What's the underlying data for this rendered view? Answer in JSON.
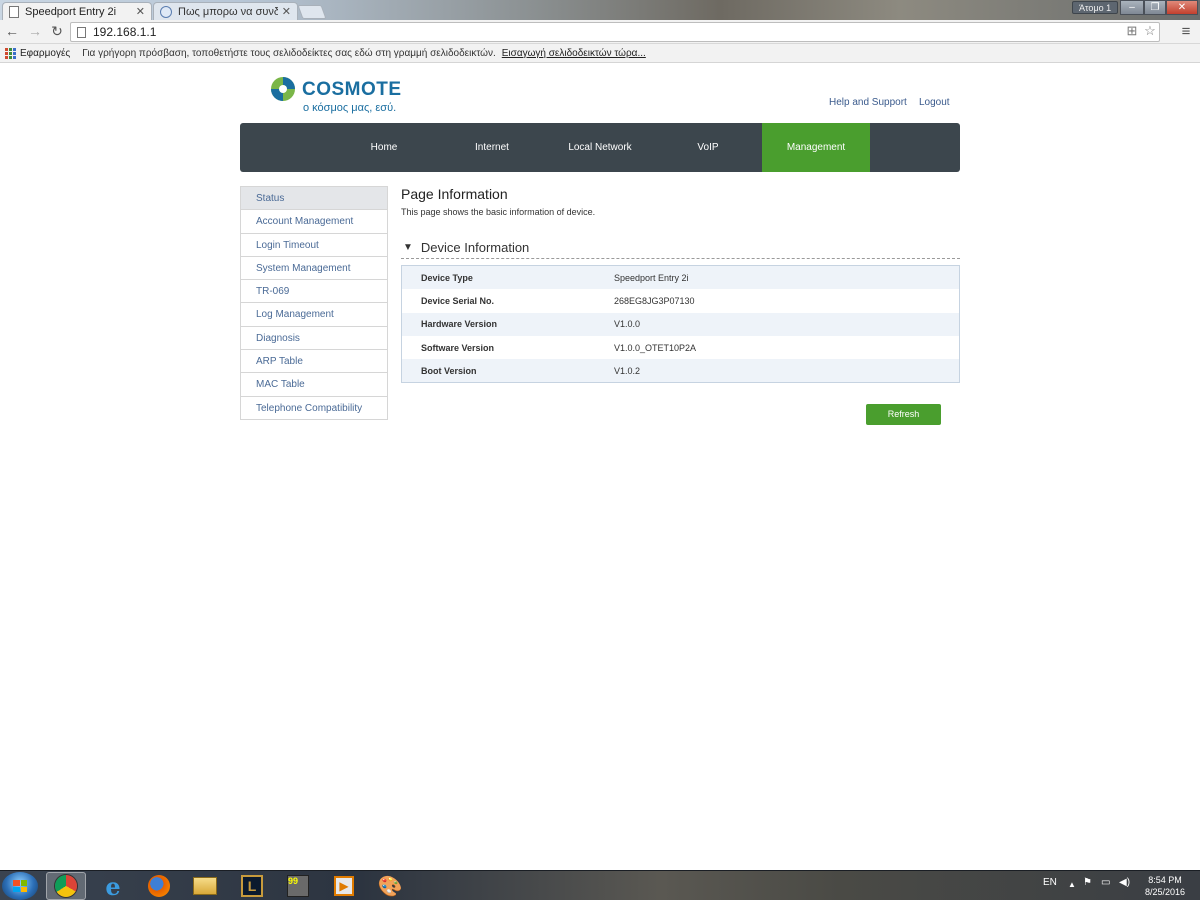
{
  "browser": {
    "tabs": [
      {
        "label": "Speedport Entry 2i",
        "active": true
      },
      {
        "label": "Πως μπορω να συνδεσω",
        "active": false
      }
    ],
    "user_badge": "Άτομο 1",
    "url": "192.168.1.1",
    "bookmarks": {
      "apps_label": "Εφαρμογές",
      "hint": "Για γρήγορη πρόσβαση, τοποθετήστε τους σελιδοδείκτες σας εδώ στη γραμμή σελιδοδεικτών.",
      "import_link": "Εισαγωγή σελιδοδεικτών τώρα..."
    }
  },
  "router": {
    "brand": "COSMOTE",
    "tagline": "ο κόσμος μας, εσύ.",
    "top_links": {
      "help": "Help and Support",
      "logout": "Logout"
    },
    "nav": [
      "Home",
      "Internet",
      "Local Network",
      "VoIP",
      "Management"
    ],
    "nav_active": "Management",
    "sidebar": [
      "Status",
      "Account Management",
      "Login Timeout",
      "System Management",
      "TR-069",
      "Log Management",
      "Diagnosis",
      "ARP Table",
      "MAC Table",
      "Telephone Compatibility"
    ],
    "sidebar_active": "Status",
    "page_title": "Page Information",
    "page_desc": "This page shows the basic information of device.",
    "section_title": "Device Information",
    "device_info": [
      {
        "label": "Device Type",
        "value": "Speedport Entry 2i"
      },
      {
        "label": "Device Serial No.",
        "value": "268EG8JG3P07130"
      },
      {
        "label": "Hardware Version",
        "value": "V1.0.0"
      },
      {
        "label": "Software Version",
        "value": "V1.0.0_OTET10P2A"
      },
      {
        "label": "Boot Version",
        "value": "V1.0.2"
      }
    ],
    "refresh_label": "Refresh",
    "colors": {
      "accent_green": "#4a9e2e",
      "nav_dark": "#3c464d",
      "brand_blue": "#1a6ea0"
    }
  },
  "taskbar": {
    "language": "EN",
    "time": "8:54 PM",
    "date": "8/25/2016",
    "apps": [
      "windows-explorer-icon",
      "chrome-icon",
      "internet-explorer-icon",
      "firefox-icon",
      "file-explorer-icon",
      "league-of-legends-icon",
      "app-99-icon",
      "media-player-icon",
      "paint-icon"
    ]
  }
}
